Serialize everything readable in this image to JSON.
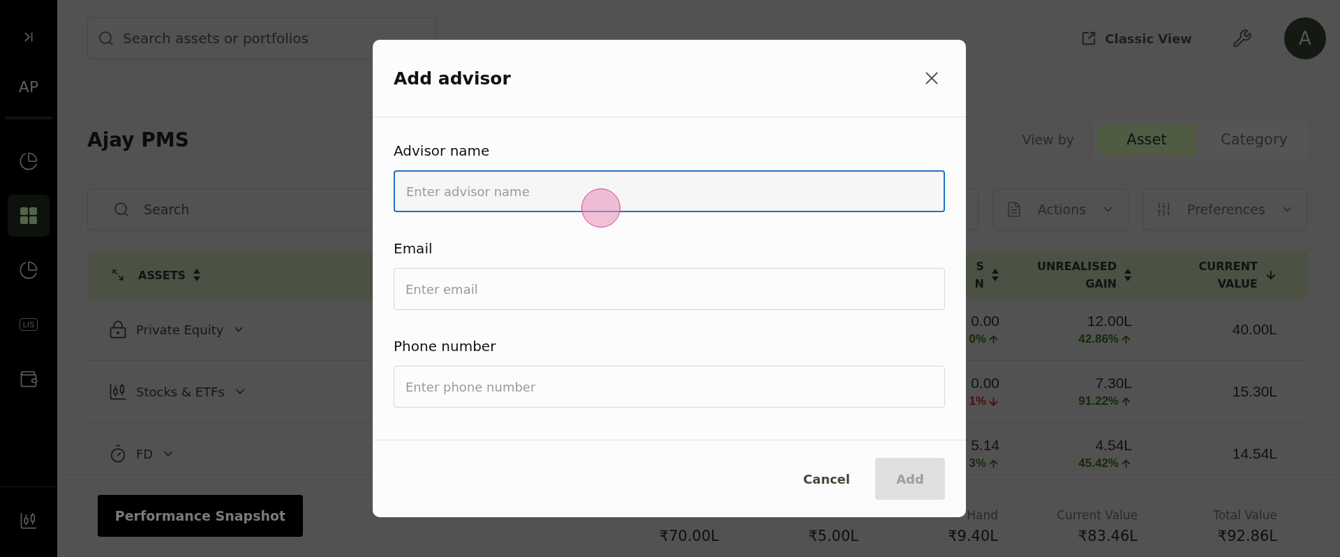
{
  "sidebar": {
    "initials": "AP",
    "items": [
      {
        "kind": "pie",
        "selected": false
      },
      {
        "kind": "grid",
        "selected": true
      },
      {
        "kind": "pie",
        "selected": false
      },
      {
        "kind": "badge",
        "label": "LIS",
        "selected": false
      },
      {
        "kind": "bag",
        "selected": false
      }
    ],
    "bottom_items": [
      {
        "kind": "candles",
        "selected": false
      }
    ]
  },
  "header": {
    "search": {
      "placeholder": "Search assets or portfolios"
    },
    "classic_view": "Classic View",
    "avatar": "A"
  },
  "portfolio": {
    "title": "Ajay PMS",
    "view_by": {
      "label": "View by",
      "options": [
        {
          "label": "Asset",
          "selected": true
        },
        {
          "label": "Category",
          "selected": false
        }
      ]
    },
    "search": {
      "placeholder": "Search"
    },
    "actions": "Actions",
    "preferences": "Preferences"
  },
  "table": {
    "columns": [
      {
        "lines": [
          "ASSETS"
        ],
        "sorted": false
      },
      {
        "lines": [
          "S",
          "N"
        ],
        "sorted": false
      },
      {
        "lines": [
          "UNREALISED",
          "GAIN"
        ],
        "sorted": false
      },
      {
        "lines": [
          "CURRENT",
          "VALUE"
        ],
        "sorted": true
      }
    ],
    "rows": [
      {
        "name": "Private Equity",
        "kind": "equity",
        "column_2": {
          "value": "0.00",
          "change": "0%",
          "up": true
        },
        "gain": {
          "value": "12.00L",
          "change": "42.86%",
          "up": true
        },
        "current_value": "40.00L"
      },
      {
        "name": "Stocks & ETFs",
        "kind": "stocks",
        "column_2": {
          "value": "0.00",
          "change": "1%",
          "up": false
        },
        "gain": {
          "value": "7.30L",
          "change": "91.22%",
          "up": true
        },
        "current_value": "15.30L"
      },
      {
        "name": "FD",
        "kind": "fd",
        "column_2": {
          "value": "5.14",
          "change": "3%",
          "up": true
        },
        "gain": {
          "value": "4.54L",
          "change": "45.42%",
          "up": true
        },
        "current_value": "14.54L"
      }
    ]
  },
  "footer": {
    "button": "Performance Snapshot",
    "summary": [
      {
        "value": "₹70.00L"
      },
      {
        "value": "₹5.00L"
      },
      {
        "label": "Hand",
        "value": "₹9.40L"
      },
      {
        "label": "Current Value",
        "value": "₹83.46L"
      },
      {
        "label": "Total Value",
        "value": "₹92.86L"
      }
    ]
  },
  "dialog": {
    "title": "Add advisor",
    "fields": [
      {
        "label": "Advisor name",
        "placeholder": "Enter advisor name",
        "focused": true
      },
      {
        "label": "Email",
        "placeholder": "Enter email",
        "focused": false
      },
      {
        "label": "Phone number",
        "placeholder": "Enter phone number",
        "focused": false
      }
    ],
    "buttons": [
      {
        "label": "Cancel",
        "kind": "text",
        "disabled": false
      },
      {
        "label": "Add",
        "kind": "primary",
        "disabled": true
      }
    ]
  }
}
